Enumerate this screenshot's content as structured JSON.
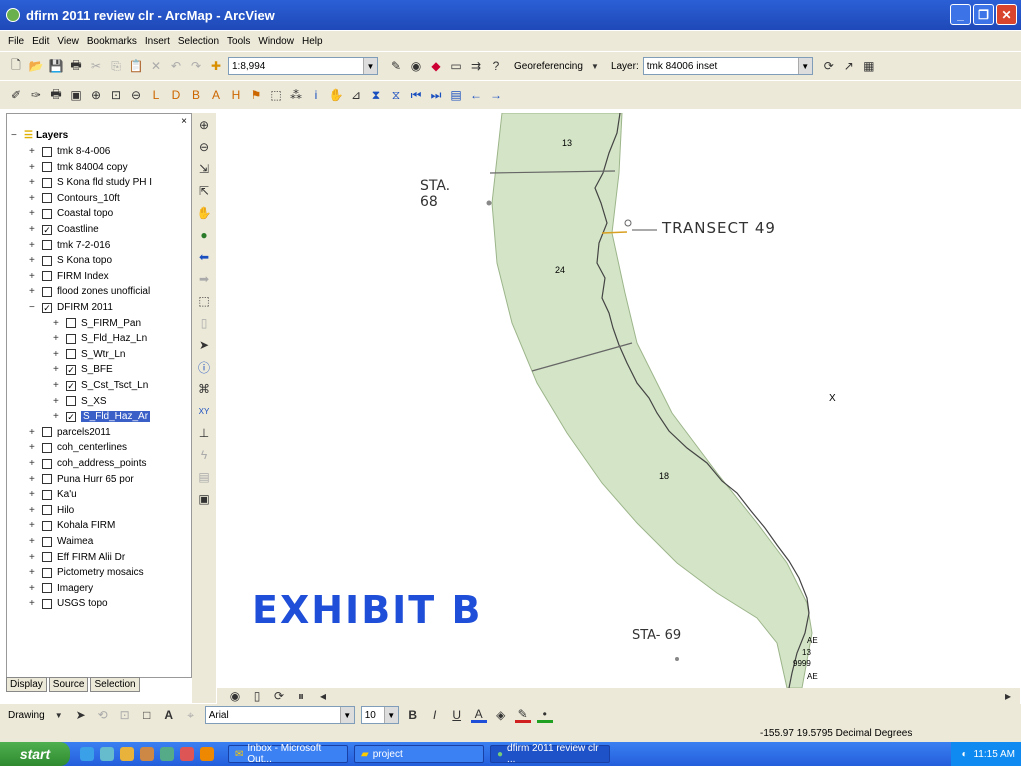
{
  "window": {
    "title": "dfirm 2011 review clr - ArcMap - ArcView"
  },
  "menu": [
    "File",
    "Edit",
    "View",
    "Bookmarks",
    "Insert",
    "Selection",
    "Tools",
    "Window",
    "Help"
  ],
  "toolbar": {
    "scale": "1:8,994",
    "georef_label": "Georeferencing",
    "layer_label": "Layer:",
    "layer_value": "tmk 84006 inset"
  },
  "toc": {
    "root": "Layers",
    "layers": [
      {
        "label": "tmk 8-4-006",
        "checked": false,
        "indent": 1
      },
      {
        "label": "tmk 84004 copy",
        "checked": false,
        "indent": 1
      },
      {
        "label": "S Kona fld study PH I",
        "checked": false,
        "indent": 1
      },
      {
        "label": "Contours_10ft",
        "checked": false,
        "indent": 1
      },
      {
        "label": "Coastal topo",
        "checked": false,
        "indent": 1
      },
      {
        "label": "Coastline",
        "checked": true,
        "indent": 1
      },
      {
        "label": "tmk 7-2-016",
        "checked": false,
        "indent": 1
      },
      {
        "label": "S Kona topo",
        "checked": false,
        "indent": 1
      },
      {
        "label": "FIRM Index",
        "checked": false,
        "indent": 1
      },
      {
        "label": "flood zones unofficial",
        "checked": false,
        "indent": 1
      },
      {
        "label": "DFIRM 2011",
        "checked": true,
        "indent": 1,
        "expanded": true
      },
      {
        "label": "S_FIRM_Pan",
        "checked": false,
        "indent": 2
      },
      {
        "label": "S_Fld_Haz_Ln",
        "checked": false,
        "indent": 2
      },
      {
        "label": "S_Wtr_Ln",
        "checked": false,
        "indent": 2
      },
      {
        "label": "S_BFE",
        "checked": true,
        "indent": 2
      },
      {
        "label": "S_Cst_Tsct_Ln",
        "checked": true,
        "indent": 2
      },
      {
        "label": "S_XS",
        "checked": false,
        "indent": 2
      },
      {
        "label": "S_Fld_Haz_Ar",
        "checked": true,
        "indent": 2,
        "selected": true
      },
      {
        "label": "parcels2011",
        "checked": false,
        "indent": 1
      },
      {
        "label": "coh_centerlines",
        "checked": false,
        "indent": 1
      },
      {
        "label": "coh_address_points",
        "checked": false,
        "indent": 1
      },
      {
        "label": "Puna Hurr 65 por",
        "checked": false,
        "indent": 1
      },
      {
        "label": "Ka'u",
        "checked": false,
        "indent": 1
      },
      {
        "label": "Hilo",
        "checked": false,
        "indent": 1
      },
      {
        "label": "Kohala FIRM",
        "checked": false,
        "indent": 1
      },
      {
        "label": "Waimea",
        "checked": false,
        "indent": 1
      },
      {
        "label": "Eff FIRM Alii Dr",
        "checked": false,
        "indent": 1
      },
      {
        "label": "Pictometry mosaics",
        "checked": false,
        "indent": 1
      },
      {
        "label": "Imagery",
        "checked": false,
        "indent": 1
      },
      {
        "label": "USGS topo",
        "checked": false,
        "indent": 1
      }
    ],
    "tabs": [
      "Display",
      "Source",
      "Selection"
    ]
  },
  "map": {
    "labels": {
      "zone1": "13",
      "zone2": "24",
      "zone3": "18"
    },
    "marker_x": "X",
    "small_labels": [
      "AE",
      "13",
      "9999",
      "AE"
    ],
    "annotations": {
      "sta68_line1": "STA.",
      "sta68_line2": "68",
      "transect": "TRANSECT 49",
      "sta69": "STA- 69",
      "exhibit": "EXHIBIT B"
    }
  },
  "drawing": {
    "label": "Drawing",
    "font": "Arial",
    "size": "10"
  },
  "status": {
    "coords": "-155.97  19.5795 Decimal Degrees"
  },
  "taskbar": {
    "start": "start",
    "items": [
      "Inbox - Microsoft Out...",
      "project",
      "dfirm 2011 review clr ..."
    ],
    "clock": "11:15 AM"
  },
  "colors": {
    "titlebar": "#2357cf",
    "zone_fill": "#d4e5c7",
    "exhibit_ink": "#1f4fd8"
  }
}
